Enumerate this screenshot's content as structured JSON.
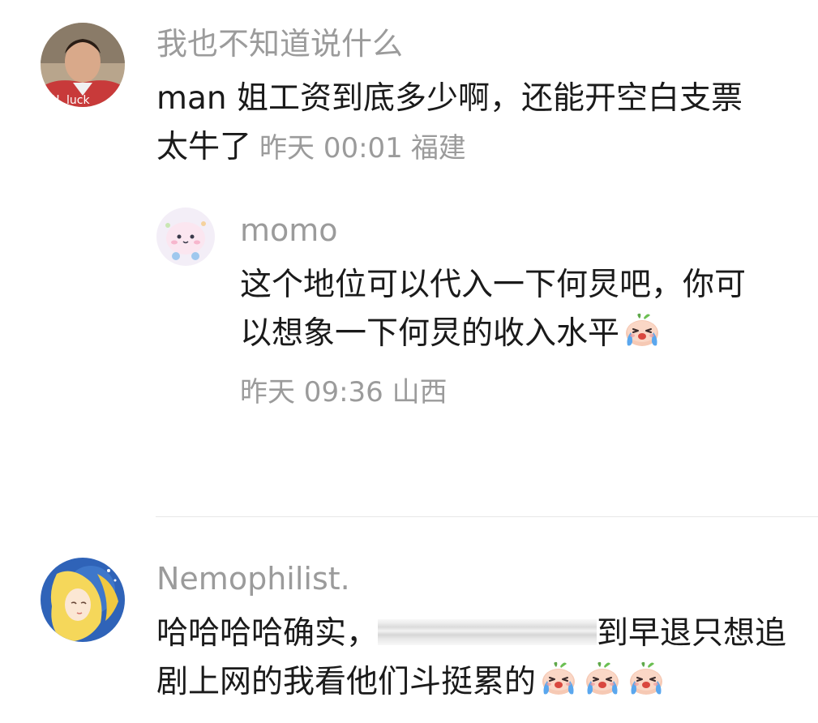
{
  "comments": [
    {
      "username": "我也不知道说什么",
      "text_line1": "man 姐工资到底多少啊，还能开空白支票",
      "text_line2": "太牛了",
      "time": "昨天 00:01",
      "location": "福建",
      "avatar_caption": "运！luck"
    },
    {
      "username": "momo",
      "text_line1": "这个地位可以代入一下何炅吧，你可",
      "text_line2": "以想象一下何炅的收入水平",
      "time": "昨天 09:36",
      "location": "山西",
      "emoji": "crying-peach-emoji"
    },
    {
      "username": "Nemophilist.",
      "text_line1_a": "哈哈哈哈确实，",
      "text_line1_b": "到早退只想追",
      "text_line2": "剧上网的我看他们斗挺累的",
      "emojis": [
        "crying-peach-emoji",
        "crying-peach-emoji",
        "crying-peach-emoji"
      ]
    }
  ],
  "colors": {
    "primary_text": "#1a1a1a",
    "secondary_text": "#9b9b9b",
    "divider": "#e8e8e8",
    "background": "#ffffff"
  }
}
